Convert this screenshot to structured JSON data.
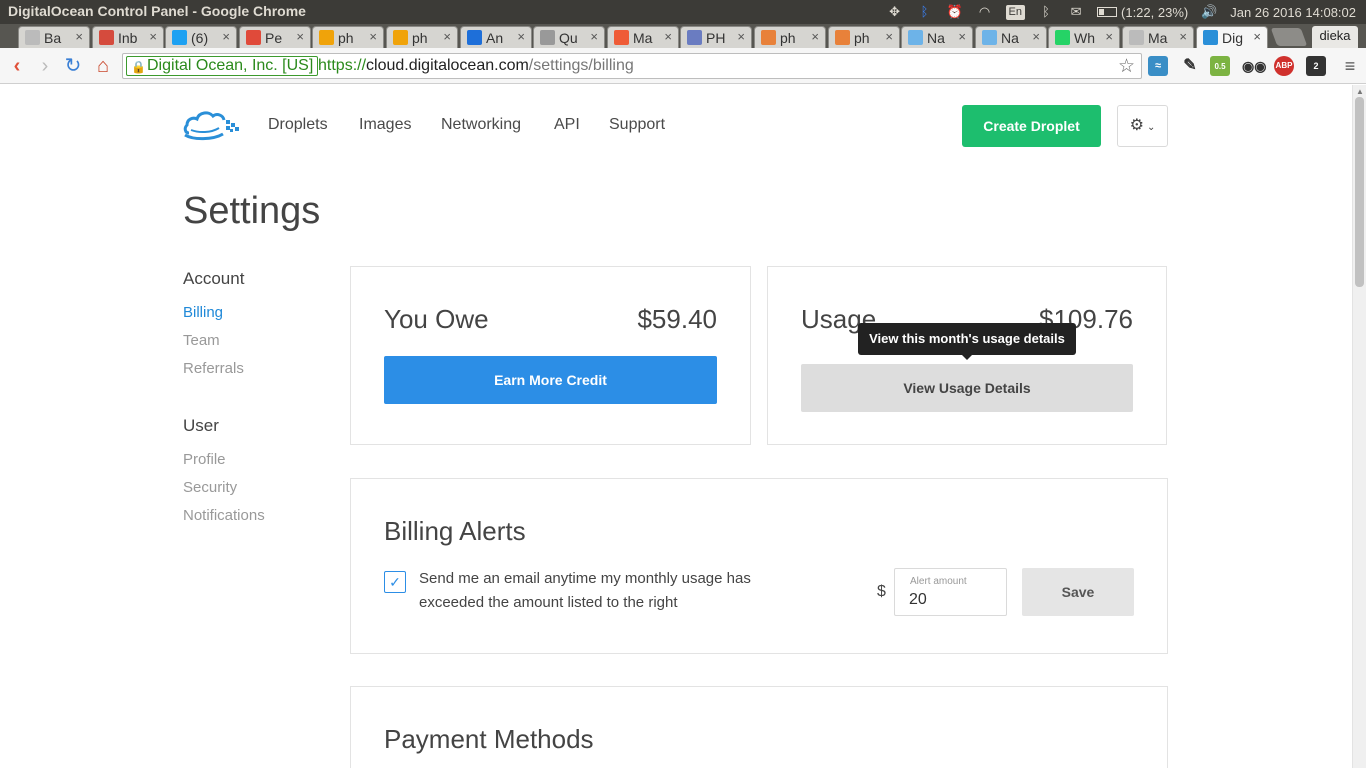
{
  "os": {
    "window_title": "DigitalOcean Control Panel - Google Chrome",
    "battery": "(1:22, 23%)",
    "keyboard_layout": "En",
    "datetime": "Jan 26 2016 14:08:02"
  },
  "browser": {
    "tabs": [
      {
        "label": "Ba",
        "icon": "page-icon",
        "color": "#bbbbbb"
      },
      {
        "label": "Inb",
        "icon": "gmail-icon",
        "color": "#d54b3d"
      },
      {
        "label": "(6)",
        "icon": "twitter-icon",
        "color": "#1da1f2"
      },
      {
        "label": "Pe",
        "icon": "gauge-icon",
        "color": "#e04a3a"
      },
      {
        "label": "ph",
        "icon": "phpmyadmin-icon",
        "color": "#f0a30a"
      },
      {
        "label": "ph",
        "icon": "phpmyadmin-icon",
        "color": "#f0a30a"
      },
      {
        "label": "An",
        "icon": "k-icon",
        "color": "#1e6fd9"
      },
      {
        "label": "Qu",
        "icon": "gear-icon",
        "color": "#999999"
      },
      {
        "label": "Ma",
        "icon": "plus-icon",
        "color": "#ef5b36"
      },
      {
        "label": "PH",
        "icon": "php-icon",
        "color": "#6a7cc1"
      },
      {
        "label": "ph",
        "icon": "feather-icon",
        "color": "#e8813a"
      },
      {
        "label": "ph",
        "icon": "feather-icon",
        "color": "#e8813a"
      },
      {
        "label": "Na",
        "icon": "music-icon",
        "color": "#6db3e8"
      },
      {
        "label": "Na",
        "icon": "music-icon",
        "color": "#6db3e8"
      },
      {
        "label": "Wh",
        "icon": "whatsapp-icon",
        "color": "#25d366"
      },
      {
        "label": "Ma",
        "icon": "page-icon",
        "color": "#bbbbbb"
      },
      {
        "label": "Dig",
        "icon": "digitalocean-icon",
        "color": "#2a8fd8"
      }
    ],
    "profile_name": "dieka",
    "ev_cert": "Digital Ocean, Inc. [US]",
    "url_scheme": "https://",
    "url_host": "cloud.digitalocean.com",
    "url_path": "/settings/billing",
    "extension_badges": {
      "abp": "ABP",
      "abp_count": "2",
      "ghost_count": "2",
      "color_count": "0.5"
    }
  },
  "header": {
    "nav": [
      "Droplets",
      "Images",
      "Networking",
      "API",
      "Support"
    ],
    "create_button": "Create Droplet",
    "brand_color": "#1dbe6e"
  },
  "page": {
    "title": "Settings"
  },
  "sidebar": {
    "account_heading": "Account",
    "account_items": [
      "Billing",
      "Team",
      "Referrals"
    ],
    "user_heading": "User",
    "user_items": [
      "Profile",
      "Security",
      "Notifications"
    ],
    "active_item": "Billing"
  },
  "owe_card": {
    "label": "You Owe",
    "value": "$59.40",
    "button": "Earn More Credit"
  },
  "usage_card": {
    "label": "Usage",
    "value": "$109.76",
    "button": "View Usage Details",
    "tooltip": "View this month's usage details"
  },
  "billing_alerts": {
    "title": "Billing Alerts",
    "checked": true,
    "description": "Send me an email anytime my monthly usage has exceeded the amount listed to the right",
    "currency_symbol": "$",
    "field_label": "Alert amount",
    "field_value": "20",
    "save_label": "Save"
  },
  "payment_methods": {
    "title": "Payment Methods"
  },
  "colors": {
    "primary_blue": "#2c8ee6",
    "link_blue": "#2089d8",
    "green": "#1dbe6e"
  }
}
